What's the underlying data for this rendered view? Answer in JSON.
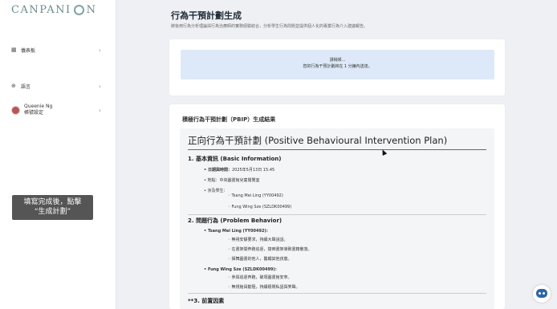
{
  "brand": {
    "logo_left": "CANPANI",
    "logo_right": "N"
  },
  "sidebar": {
    "items": [
      {
        "label": "儀表板",
        "icon": "dashboard-icon"
      },
      {
        "label": "語言",
        "icon": "globe-icon"
      }
    ],
    "user": {
      "name": "Queenie Ng",
      "sub": "帳號設定"
    }
  },
  "hint": {
    "line1": "填寫完成後，點擊",
    "line2": "“生成計劃”"
  },
  "page": {
    "title": "行為干預計劃生成",
    "subtitle": "將後用行為分析理論與行為治療師的實務經驗結合，分析學生行為問題並提供個人化的專業行為介入建議報告。"
  },
  "status": {
    "line1": "請稍候...",
    "line2": "您的行為干預計劃將在 1 分鐘內送達。"
  },
  "result": {
    "title": "積極行為干預計劃（PBIP）生成結果",
    "doc_title": "正向行為干預計劃 (Positive Behavioural Intervention Plan)",
    "s1": {
      "heading": "1. 基本資訊 (Basic Information)",
      "date_label": "日期與時間：",
      "date_value": "2025年5月13日 15:45",
      "place": "地點：中央圖書館兒童閱覽室",
      "students_label": "涉及學生：",
      "students": [
        "Tsang Mei Ling (YY00492)",
        "Fung Wing Sze (SZLDK00499)"
      ]
    },
    "s2": {
      "heading": "2. 問題行為 (Problem Behavior)",
      "student1": "Tsang Mei Ling (YY00492):",
      "s1_items": [
        "無視安靜要求，持續大聲說話。",
        "在書架間奔跑追逐，撞倒書架導致書籍散落。",
        "揮舞圖書的他人，醫觸其他孩童。"
      ],
      "student2": "Fung Wing Sze (SZLDK00499):",
      "s2_items": [
        "參與追逐奔跑，破壞圖書館安寧。",
        "無視館員勸阻，持續嬉鬧私語與笑聲。"
      ]
    },
    "s3": {
      "heading": "**3. 前置因素"
    }
  }
}
